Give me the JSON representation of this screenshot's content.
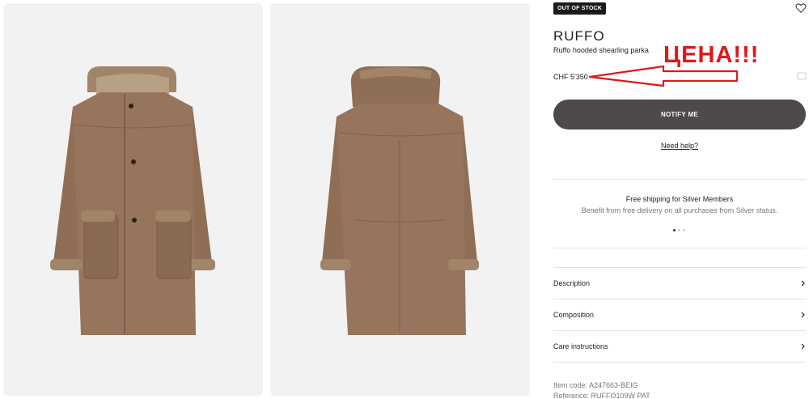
{
  "status_badge": "OUT OF STOCK",
  "product": {
    "brand": "RUFFO",
    "name": "Ruffo hooded shearling parka",
    "price": "CHF 5'350"
  },
  "annotation": "ЦЕНА!!!",
  "notify_label": "NOTIFY ME",
  "help_link": "Need help?",
  "promo": {
    "title": "Free shipping for Silver Members",
    "text": "Benefit from free delivery on all purchases from Silver status.",
    "slide_count": 3,
    "active_slide": 1
  },
  "accordions": [
    {
      "label": "Description"
    },
    {
      "label": "Composition"
    },
    {
      "label": "Care instructions"
    }
  ],
  "item_code": "Item code: A247663-BEIG",
  "reference": "Reference: RUFFO109W PAT",
  "colors": {
    "coat": "#8f6e56",
    "shearling": "#a08568",
    "button": "#4f4a49",
    "annotation": "#e01818"
  }
}
